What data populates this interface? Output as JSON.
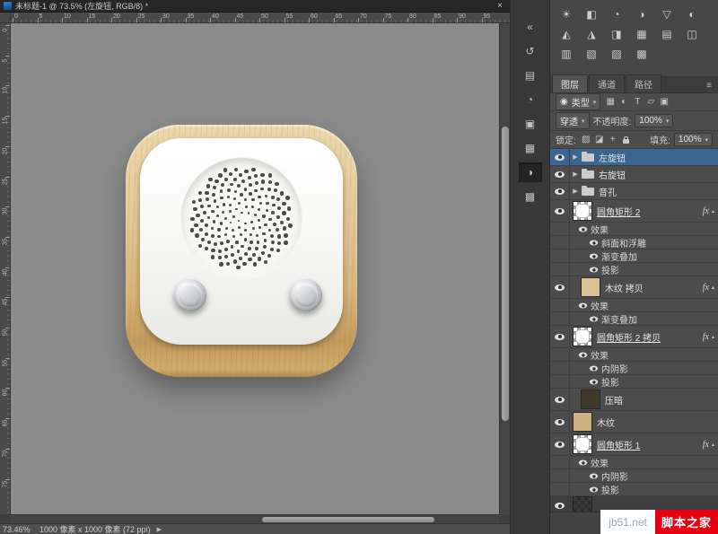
{
  "colors": {
    "selection_blue": "#3a668f",
    "wood": "#dcc08d",
    "brand_red": "#e60012",
    "canvas_gray": "#8b8b8b",
    "panel_gray": "#4c4c4c"
  },
  "titlebar": {
    "title": "未标题-1 @ 73.5% (左旋钮, RGB/8) *",
    "close_glyph": "×"
  },
  "rulers": {
    "top": [
      "0",
      "5",
      "10",
      "15",
      "20",
      "25",
      "30",
      "35",
      "40",
      "45",
      "50",
      "55",
      "60",
      "65",
      "70",
      "75",
      "80",
      "85",
      "90",
      "95"
    ],
    "left": [
      "0",
      "5",
      "10",
      "15",
      "20",
      "25",
      "30",
      "35",
      "40",
      "45",
      "50",
      "55",
      "60",
      "65",
      "70",
      "75"
    ]
  },
  "statusbar": {
    "zoom": "73.46%",
    "doc_info": "1000 像素 x 1000 像素 (72 ppi)",
    "arrow_glyph": "▶"
  },
  "side_strip": {
    "icons": [
      {
        "name": "collapse-panels-icon",
        "glyph": "«"
      },
      {
        "name": "history-icon",
        "glyph": "↺"
      },
      {
        "name": "navigator-icon",
        "glyph": "▤"
      },
      {
        "name": "info-icon",
        "glyph": "◔"
      },
      {
        "name": "color-icon",
        "glyph": "▣"
      },
      {
        "name": "swatches-icon",
        "glyph": "▦"
      },
      {
        "name": "adjustments-collapsed-icon",
        "glyph": "◑",
        "active": true
      },
      {
        "name": "styles-icon",
        "glyph": "▩"
      }
    ]
  },
  "adjustments": {
    "icons": [
      {
        "name": "brightness-contrast-icon",
        "glyph": "☀"
      },
      {
        "name": "levels-icon",
        "glyph": "◧"
      },
      {
        "name": "curves-icon",
        "glyph": "◔"
      },
      {
        "name": "exposure-icon",
        "glyph": "◑"
      },
      {
        "name": "vibrance-icon",
        "glyph": "▽"
      },
      {
        "name": "hue-saturation-icon",
        "glyph": "◐"
      },
      {
        "name": "color-balance-icon",
        "glyph": "◭"
      },
      {
        "name": "black-white-icon",
        "glyph": "◮"
      },
      {
        "name": "photo-filter-icon",
        "glyph": "◨"
      },
      {
        "name": "channel-mixer-icon",
        "glyph": "▦"
      },
      {
        "name": "color-lookup-icon",
        "glyph": "▤"
      },
      {
        "name": "invert-icon",
        "glyph": "◫"
      },
      {
        "name": "posterize-icon",
        "glyph": "▥"
      },
      {
        "name": "threshold-icon",
        "glyph": "▧"
      },
      {
        "name": "selective-color-icon",
        "glyph": "▨"
      },
      {
        "name": "gradient-map-icon",
        "glyph": "▩"
      }
    ]
  },
  "layers_panel": {
    "tabs": [
      {
        "label": "图层",
        "active": true
      },
      {
        "label": "通道",
        "active": false
      },
      {
        "label": "路径",
        "active": false
      }
    ],
    "panel_menu_glyph": "≡",
    "filter": {
      "search_glyph": "◉",
      "kind": "类型",
      "dropdown_glyph": "▾",
      "icons": [
        {
          "name": "filter-pixel-layers-icon",
          "glyph": "▦"
        },
        {
          "name": "filter-adjustment-layers-icon",
          "glyph": "◐"
        },
        {
          "name": "filter-type-layers-icon",
          "glyph": "T"
        },
        {
          "name": "filter-shape-layers-icon",
          "glyph": "▱"
        },
        {
          "name": "filter-smart-objects-icon",
          "glyph": "▣"
        }
      ]
    },
    "blend": {
      "mode": "穿透",
      "dropdown_glyph": "▾",
      "opacity_label": "不透明度:",
      "opacity_value": "100%"
    },
    "lock": {
      "label": "锁定:",
      "fill_label": "填充:",
      "fill_value": "100%",
      "icons": [
        {
          "name": "lock-transparent-pixels-icon",
          "glyph": "▨"
        },
        {
          "name": "lock-image-pixels-icon",
          "glyph": "◪"
        },
        {
          "name": "lock-position-icon",
          "glyph": "+"
        },
        {
          "name": "lock-all-icon",
          "glyph": "LOCK"
        }
      ]
    },
    "fx_label": "fx",
    "rows": [
      {
        "type": "group",
        "name": "左旋钮",
        "selected": true
      },
      {
        "type": "group",
        "name": "右旋钮"
      },
      {
        "type": "group",
        "name": "音孔"
      },
      {
        "type": "layer",
        "name": "圆角矩形 2",
        "thumb": "shape-white",
        "fx": true,
        "underline": true
      },
      {
        "type": "fxh",
        "name": "效果"
      },
      {
        "type": "fxi",
        "name": "斜面和浮雕"
      },
      {
        "type": "fxi",
        "name": "渐变叠加"
      },
      {
        "type": "fxi",
        "name": "投影"
      },
      {
        "type": "layer",
        "name": "木纹 拷贝",
        "thumb": "tan",
        "fx": true,
        "clipped": true
      },
      {
        "type": "fxh",
        "name": "效果"
      },
      {
        "type": "fxi",
        "name": "渐变叠加"
      },
      {
        "type": "layer",
        "name": "圆角矩形 2 拷贝",
        "thumb": "shape-white",
        "fx": true,
        "underline": true
      },
      {
        "type": "fxh",
        "name": "效果"
      },
      {
        "type": "fxi",
        "name": "内阴影"
      },
      {
        "type": "fxi",
        "name": "投影"
      },
      {
        "type": "layer",
        "name": "压暗",
        "thumb": "dark",
        "clipped": true
      },
      {
        "type": "layer",
        "name": "木纹",
        "thumb": "tan2"
      },
      {
        "type": "layer",
        "name": "圆角矩形 1",
        "thumb": "shape-white",
        "fx": true,
        "underline": true
      },
      {
        "type": "fxh",
        "name": "效果"
      },
      {
        "type": "fxi",
        "name": "内阴影"
      },
      {
        "type": "fxi",
        "name": "投影"
      },
      {
        "type": "layer",
        "name": "",
        "thumb": "darkgray",
        "partial": true
      }
    ]
  },
  "watermark": {
    "site": "jb51.net",
    "brand": "脚本之家"
  }
}
